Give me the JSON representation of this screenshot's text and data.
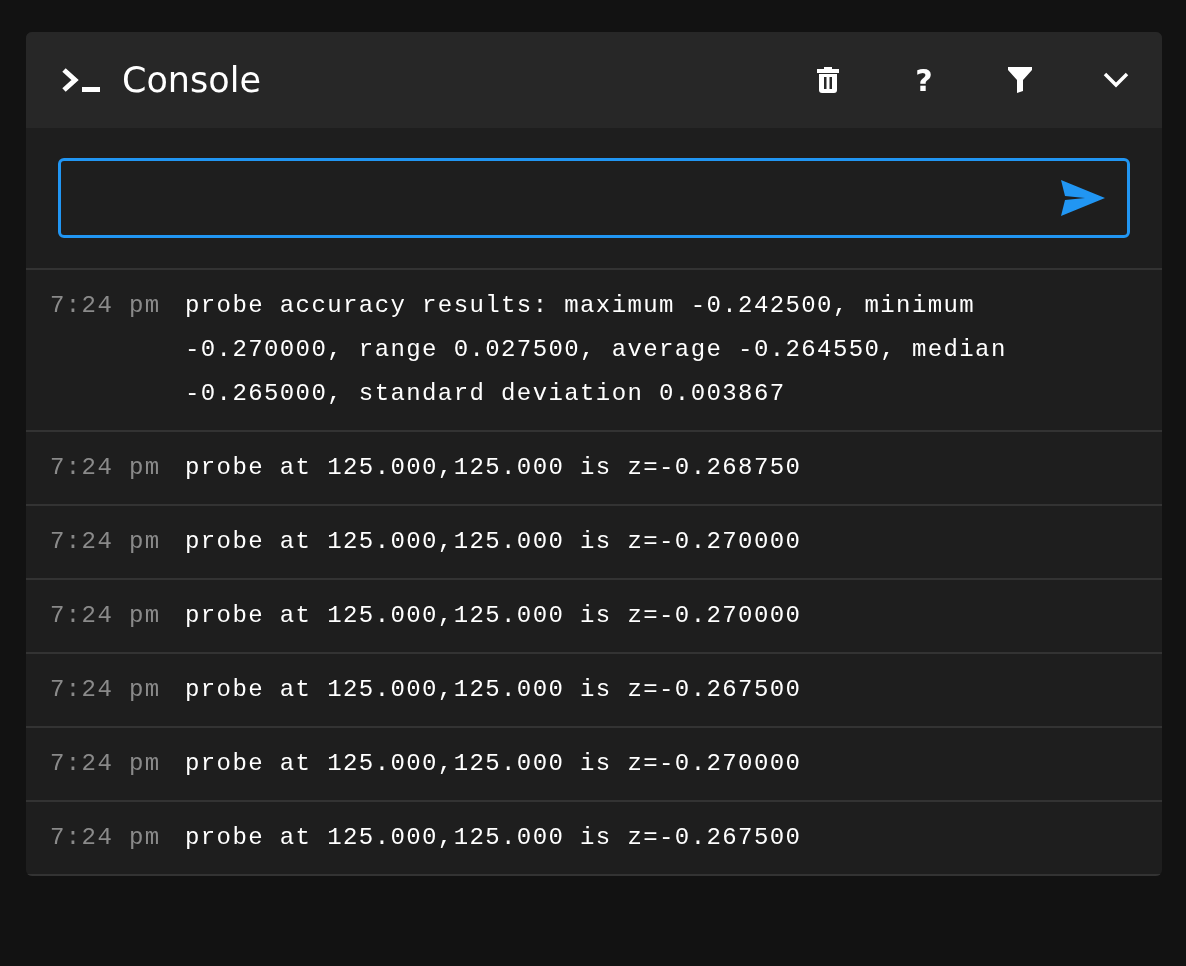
{
  "header": {
    "title": "Console",
    "help_glyph": "?"
  },
  "log": [
    {
      "time": "7:24 pm",
      "message": "probe accuracy results: maximum -0.242500, minimum -0.270000, range 0.027500, average -0.264550, median -0.265000, standard deviation 0.003867"
    },
    {
      "time": "7:24 pm",
      "message": "probe at 125.000,125.000 is z=-0.268750"
    },
    {
      "time": "7:24 pm",
      "message": "probe at 125.000,125.000 is z=-0.270000"
    },
    {
      "time": "7:24 pm",
      "message": "probe at 125.000,125.000 is z=-0.270000"
    },
    {
      "time": "7:24 pm",
      "message": "probe at 125.000,125.000 is z=-0.267500"
    },
    {
      "time": "7:24 pm",
      "message": "probe at 125.000,125.000 is z=-0.270000"
    },
    {
      "time": "7:24 pm",
      "message": "probe at 125.000,125.000 is z=-0.267500"
    }
  ]
}
